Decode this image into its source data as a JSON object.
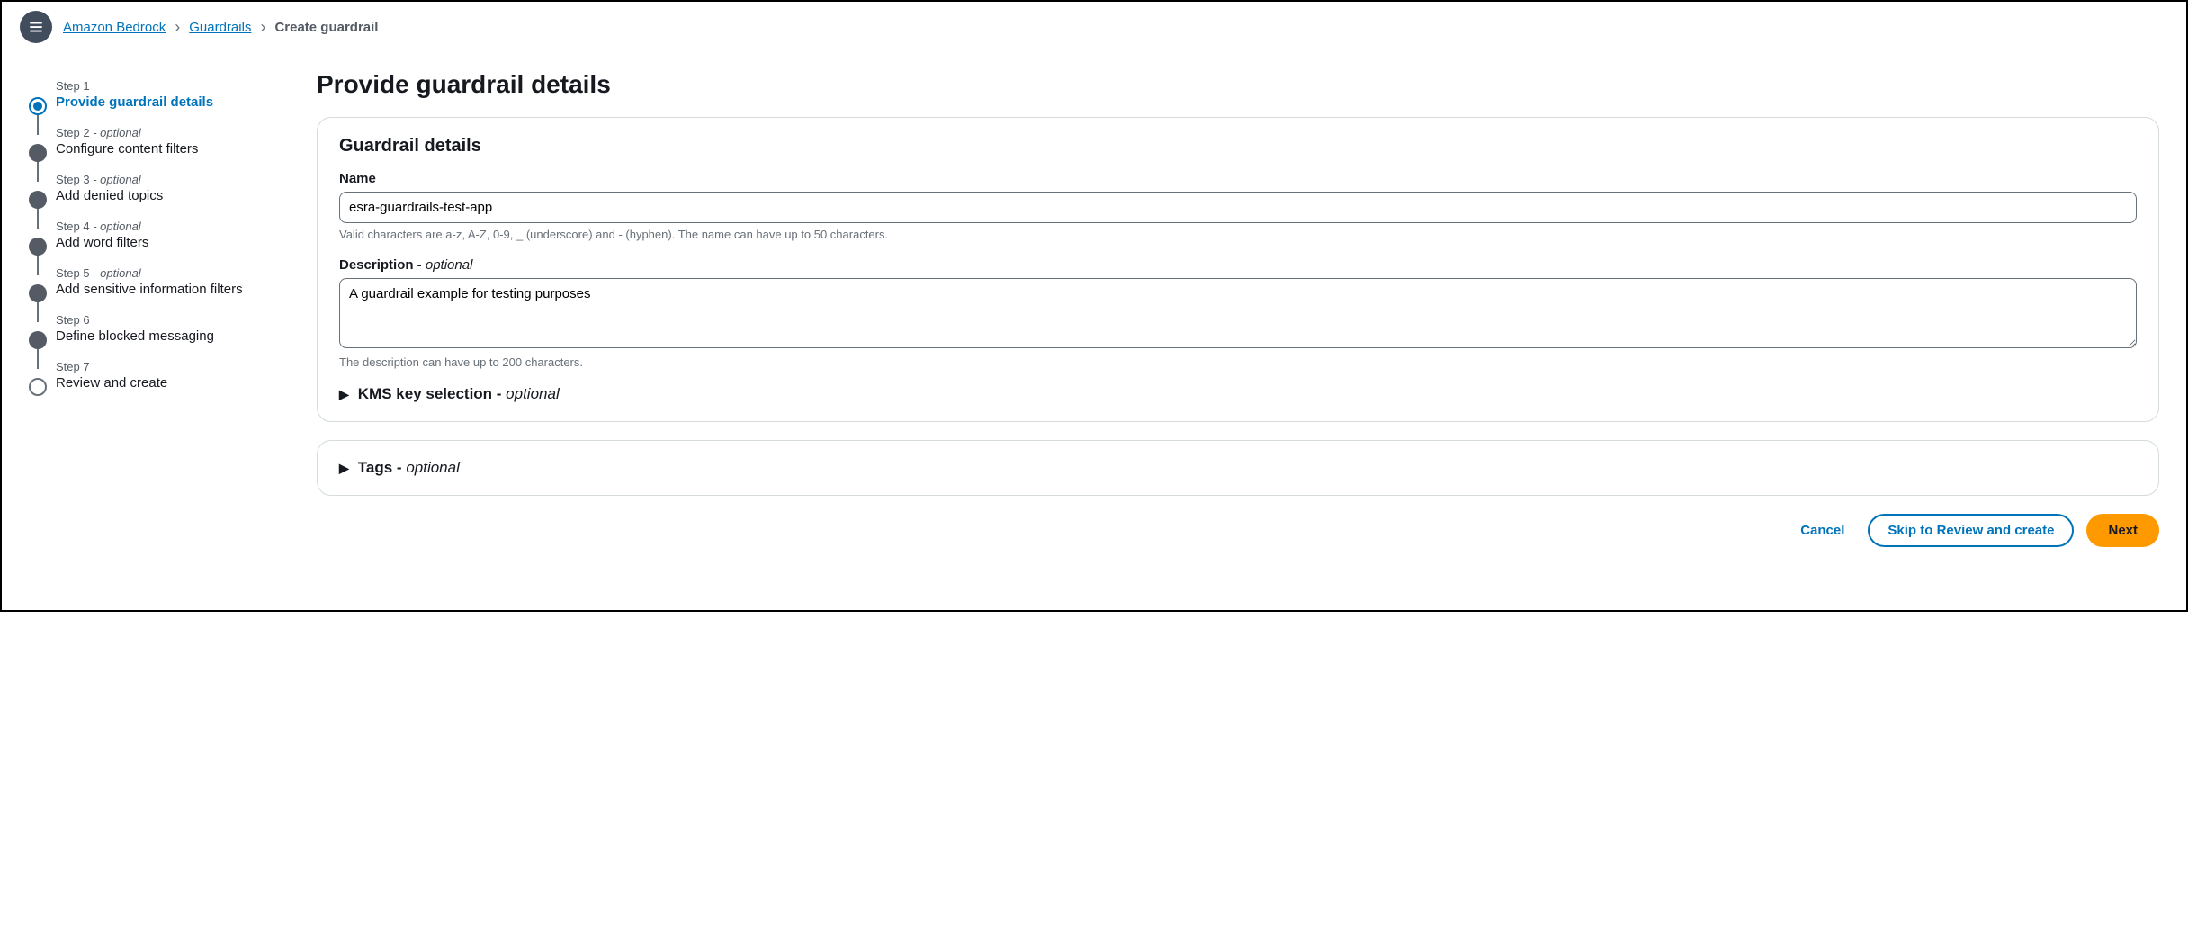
{
  "breadcrumb": {
    "items": [
      {
        "label": "Amazon Bedrock",
        "link": true
      },
      {
        "label": "Guardrails",
        "link": true
      },
      {
        "label": "Create guardrail",
        "link": false
      }
    ]
  },
  "wizard": {
    "steps": [
      {
        "num": "Step 1",
        "optional": "",
        "title": "Provide guardrail details",
        "state": "active"
      },
      {
        "num": "Step 2",
        "optional": " - optional",
        "title": "Configure content filters",
        "state": "filled"
      },
      {
        "num": "Step 3",
        "optional": " - optional",
        "title": "Add denied topics",
        "state": "filled"
      },
      {
        "num": "Step 4",
        "optional": " - optional",
        "title": "Add word filters",
        "state": "filled"
      },
      {
        "num": "Step 5",
        "optional": " - optional",
        "title": "Add sensitive information filters",
        "state": "filled"
      },
      {
        "num": "Step 6",
        "optional": "",
        "title": "Define blocked messaging",
        "state": "filled"
      },
      {
        "num": "Step 7",
        "optional": "",
        "title": "Review and create",
        "state": "hollow"
      }
    ]
  },
  "page": {
    "title": "Provide guardrail details"
  },
  "panel1": {
    "title": "Guardrail details",
    "name_label": "Name",
    "name_value": "esra-guardrails-test-app",
    "name_hint": "Valid characters are a-z, A-Z, 0-9, _ (underscore) and - (hyphen). The name can have up to 50 characters.",
    "desc_label": "Description - ",
    "desc_optional": "optional",
    "desc_value": "A guardrail example for testing purposes",
    "desc_hint": "The description can have up to 200 characters.",
    "kms_label": "KMS key selection - ",
    "kms_optional": "optional"
  },
  "panel2": {
    "tags_label": "Tags - ",
    "tags_optional": "optional"
  },
  "footer": {
    "cancel": "Cancel",
    "skip": "Skip to Review and create",
    "next": "Next"
  }
}
